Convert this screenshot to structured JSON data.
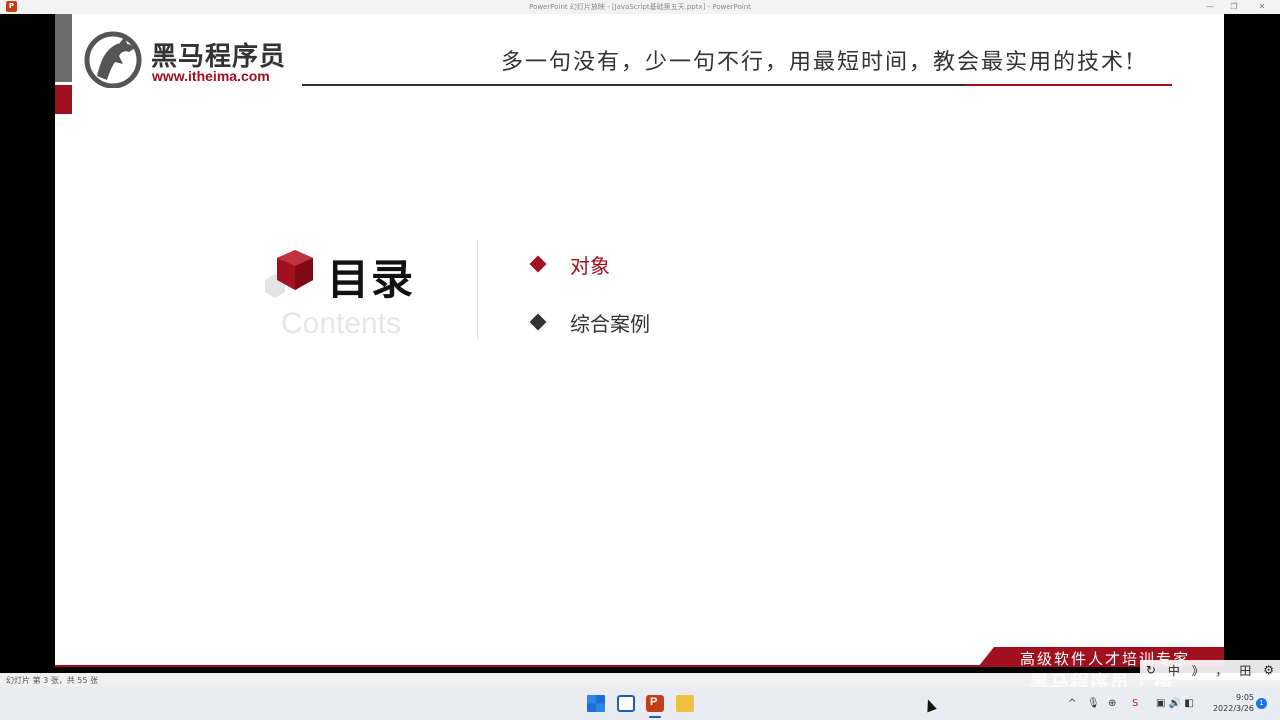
{
  "window": {
    "title": "PowerPoint 幻灯片放映 - [JavaScript基础第五天.pptx] - PowerPoint",
    "minimize_icon": "minimize-icon",
    "restore_icon": "restore-icon",
    "close_icon": "close-icon"
  },
  "slide": {
    "brand_name": "黑马程序员",
    "brand_url": "www.itheima.com",
    "slogan": "多一句没有，少一句不行，用最短时间，教会最实用的技术!",
    "toc_title": "目录",
    "toc_subtitle": "Contents",
    "toc_items": [
      {
        "label": "对象",
        "active": true
      },
      {
        "label": "综合案例",
        "active": false
      }
    ],
    "footer_banner": "高级软件人才培训专家",
    "colors": {
      "accent": "#a0101e",
      "text": "#333333"
    }
  },
  "statusbar": {
    "slide_info": "幻灯片 第 3 张，共 55 张"
  },
  "ime": {
    "items": [
      "中",
      "》",
      "，",
      "田",
      "⚙"
    ]
  },
  "watermark": "黑马程序员 · 播",
  "taskbar": {
    "apps": [
      "start-icon",
      "task-view-icon",
      "powerpoint-icon",
      "file-explorer-icon"
    ],
    "tray": {
      "chevron": "^",
      "mic": "🎙",
      "network": "⊕",
      "s_icon": "S",
      "status": "▣ 🔊 ◧"
    },
    "time": "9:05",
    "date": "2022/3/26",
    "notification_count": "1"
  }
}
